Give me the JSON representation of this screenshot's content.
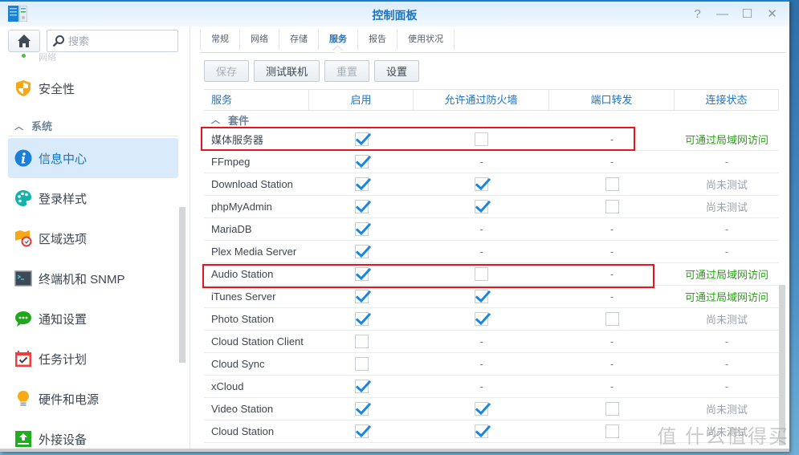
{
  "window": {
    "title": "控制面板",
    "controls": {
      "help": "?",
      "minimize": "—",
      "maximize": "☐",
      "close": "✕"
    }
  },
  "sidebar": {
    "search_placeholder": "搜索",
    "faded_label": "网络",
    "items_top": [
      {
        "label": "安全性",
        "icon": "shield-icon"
      }
    ],
    "group_label": "系统",
    "items": [
      {
        "label": "信息中心",
        "icon": "info-icon",
        "active": true
      },
      {
        "label": "登录样式",
        "icon": "palette-icon"
      },
      {
        "label": "区域选项",
        "icon": "map-clock-icon"
      },
      {
        "label": "终端机和 SNMP",
        "icon": "terminal-icon"
      },
      {
        "label": "通知设置",
        "icon": "chat-bubble-icon"
      },
      {
        "label": "任务计划",
        "icon": "calendar-check-icon"
      },
      {
        "label": "硬件和电源",
        "icon": "lightbulb-icon"
      },
      {
        "label": "外接设备",
        "icon": "external-device-icon"
      }
    ]
  },
  "tabs": [
    {
      "label": "常规"
    },
    {
      "label": "网络"
    },
    {
      "label": "存储"
    },
    {
      "label": "服务",
      "active": true
    },
    {
      "label": "报告"
    },
    {
      "label": "使用状况"
    }
  ],
  "toolbar": {
    "save": "保存",
    "test_connection": "测试联机",
    "reset": "重置",
    "settings": "设置"
  },
  "grid": {
    "headers": {
      "service": "服务",
      "enabled": "启用",
      "firewall": "允许通过防火墙",
      "port_forward": "端口转发",
      "status": "连接状态"
    },
    "group_label": "套件",
    "rows": [
      {
        "service": "媒体服务器",
        "enabled": true,
        "firewall": false,
        "port_forward": "-",
        "status": "可通过局域网访问",
        "status_type": "ok",
        "highlighted": true
      },
      {
        "service": "FFmpeg",
        "enabled": true,
        "firewall": "-",
        "port_forward": "-",
        "status": "-",
        "status_type": "dash"
      },
      {
        "service": "Download Station",
        "enabled": true,
        "firewall": true,
        "port_forward": false,
        "status": "尚未测试",
        "status_type": "untested"
      },
      {
        "service": "phpMyAdmin",
        "enabled": true,
        "firewall": true,
        "port_forward": false,
        "status": "尚未测试",
        "status_type": "untested"
      },
      {
        "service": "MariaDB",
        "enabled": true,
        "firewall": "-",
        "port_forward": "-",
        "status": "-",
        "status_type": "dash"
      },
      {
        "service": "Plex Media Server",
        "enabled": true,
        "firewall": "-",
        "port_forward": "-",
        "status": "-",
        "status_type": "dash"
      },
      {
        "service": "Audio Station",
        "enabled": true,
        "firewall": false,
        "port_forward": "-",
        "status": "可通过局域网访问",
        "status_type": "ok",
        "highlighted": true
      },
      {
        "service": "iTunes Server",
        "enabled": true,
        "firewall": true,
        "port_forward": "-",
        "status": "可通过局域网访问",
        "status_type": "ok"
      },
      {
        "service": "Photo Station",
        "enabled": true,
        "firewall": true,
        "port_forward": false,
        "status": "尚未测试",
        "status_type": "untested"
      },
      {
        "service": "Cloud Station Client",
        "enabled": false,
        "firewall": "-",
        "port_forward": "-",
        "status": "-",
        "status_type": "dash"
      },
      {
        "service": "Cloud Sync",
        "enabled": false,
        "firewall": "-",
        "port_forward": "-",
        "status": "-",
        "status_type": "dash"
      },
      {
        "service": "xCloud",
        "enabled": true,
        "firewall": "-",
        "port_forward": "-",
        "status": "-",
        "status_type": "dash"
      },
      {
        "service": "Video Station",
        "enabled": true,
        "firewall": true,
        "port_forward": false,
        "status": "尚未测试",
        "status_type": "untested"
      },
      {
        "service": "Cloud Station",
        "enabled": true,
        "firewall": true,
        "port_forward": false,
        "status": "尚未测试",
        "status_type": "untested"
      }
    ]
  },
  "watermark": "值 什么值得买",
  "colors": {
    "accent": "#1a73c7",
    "status_ok": "#2aa317",
    "highlight_box": "#e8141b",
    "active_sidebar_bg": "#d9ebfb"
  }
}
